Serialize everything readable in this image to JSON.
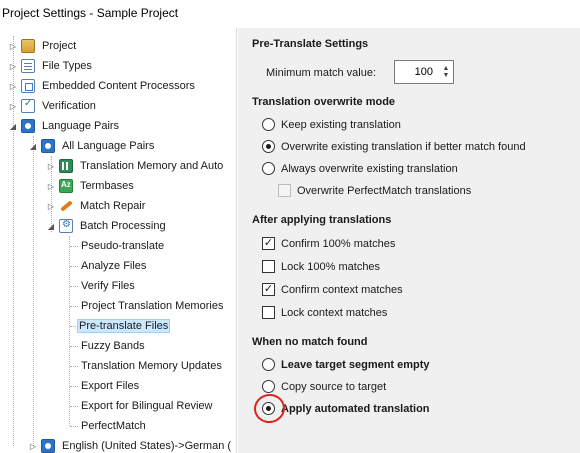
{
  "window": {
    "title": "Project Settings - Sample Project"
  },
  "tree": {
    "items": [
      {
        "label": "Project",
        "icon": "project-icon"
      },
      {
        "label": "File Types",
        "icon": "file-types-icon"
      },
      {
        "label": "Embedded Content Processors",
        "icon": "embedded-content-icon"
      },
      {
        "label": "Verification",
        "icon": "verification-icon"
      },
      {
        "label": "Language Pairs",
        "icon": "language-pairs-icon"
      },
      {
        "label": "All Language Pairs",
        "icon": "language-pair-icon"
      },
      {
        "label": "Translation Memory and Auto",
        "icon": "translation-memory-icon"
      },
      {
        "label": "Termbases",
        "icon": "termbase-icon"
      },
      {
        "label": "Match Repair",
        "icon": "match-repair-icon"
      },
      {
        "label": "Batch Processing",
        "icon": "batch-processing-icon"
      },
      {
        "label": "Pseudo-translate"
      },
      {
        "label": "Analyze Files"
      },
      {
        "label": "Verify Files"
      },
      {
        "label": "Project Translation Memories"
      },
      {
        "label": "Pre-translate Files",
        "selected": true
      },
      {
        "label": "Fuzzy Bands"
      },
      {
        "label": "Translation Memory Updates"
      },
      {
        "label": "Export Files"
      },
      {
        "label": "Export for Bilingual Review"
      },
      {
        "label": "PerfectMatch"
      },
      {
        "label": "English (United States)->German (",
        "icon": "language-pair-icon"
      }
    ]
  },
  "panel": {
    "heading": "Pre-Translate Settings",
    "min_match_label": "Minimum match value:",
    "min_match_value": "100",
    "overwrite": {
      "title": "Translation overwrite mode",
      "options": [
        {
          "label": "Keep existing translation",
          "selected": false
        },
        {
          "label": "Overwrite existing translation if better match found",
          "selected": true
        },
        {
          "label": "Always overwrite existing translation",
          "selected": false
        }
      ],
      "perfectmatch_label": "Overwrite PerfectMatch translations",
      "perfectmatch_checked": false
    },
    "after": {
      "title": "After applying translations",
      "options": [
        {
          "label": "Confirm 100% matches",
          "checked": true
        },
        {
          "label": "Lock 100% matches",
          "checked": false
        },
        {
          "label": "Confirm context matches",
          "checked": true
        },
        {
          "label": "Lock context matches",
          "checked": false
        }
      ]
    },
    "nomatch": {
      "title": "When no match found",
      "options": [
        {
          "label": "Leave target segment empty",
          "selected": false
        },
        {
          "label": "Copy source to target",
          "selected": false
        },
        {
          "label": "Apply automated translation",
          "selected": true
        }
      ]
    }
  },
  "colors": {
    "panel_bg": "#f0f0f0",
    "selection_bg": "#cce8ff",
    "annotation_red": "#d9261c"
  }
}
